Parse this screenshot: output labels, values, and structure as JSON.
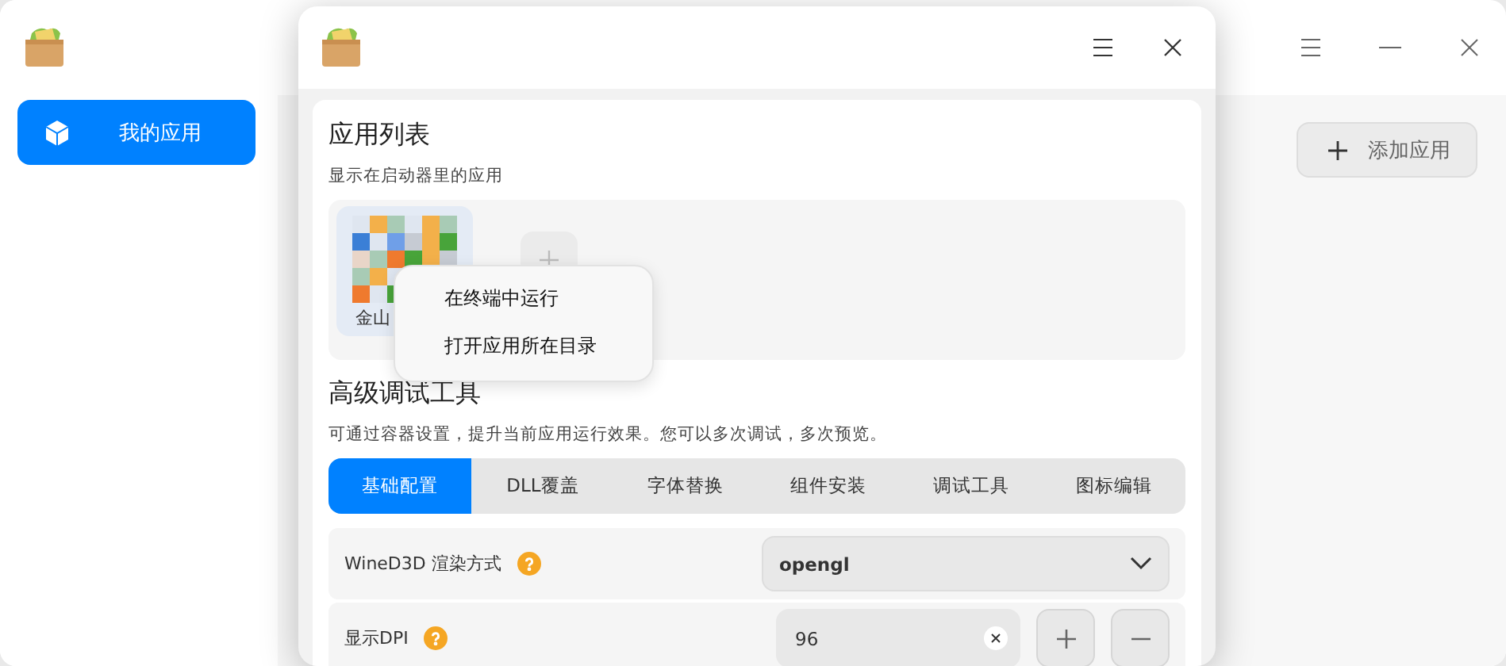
{
  "main_window": {
    "sidebar": {
      "items": [
        {
          "label": "我的应用",
          "selected": true
        }
      ]
    },
    "add_button": {
      "label": "添加应用"
    }
  },
  "dialog": {
    "app_list": {
      "title": "应用列表",
      "description": "显示在启动器里的应用",
      "apps": [
        {
          "label": "金山"
        }
      ]
    },
    "context_menu": {
      "items": [
        {
          "label": "在终端中运行"
        },
        {
          "label": "打开应用所在目录"
        }
      ]
    },
    "advanced": {
      "title": "高级调试工具",
      "description": "可通过容器设置，提升当前应用运行效果。您可以多次调试，多次预览。",
      "tabs": [
        {
          "label": "基础配置",
          "selected": true
        },
        {
          "label": "DLL覆盖",
          "selected": false
        },
        {
          "label": "字体替换",
          "selected": false
        },
        {
          "label": "组件安装",
          "selected": false
        },
        {
          "label": "调试工具",
          "selected": false
        },
        {
          "label": "图标编辑",
          "selected": false
        }
      ],
      "settings": [
        {
          "kind": "select",
          "label": "WineD3D 渲染方式",
          "value": "opengl"
        },
        {
          "kind": "number",
          "label": "显示DPI",
          "value": "96"
        }
      ]
    }
  }
}
